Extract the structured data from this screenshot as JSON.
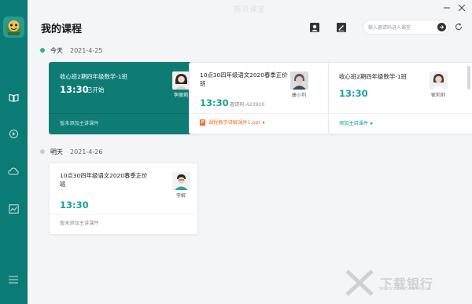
{
  "window": {
    "title": "腾讯课堂",
    "controls": [
      "minimize",
      "close"
    ]
  },
  "sidebar": {
    "items": [
      {
        "icon": "book-icon"
      },
      {
        "icon": "replay-icon"
      },
      {
        "icon": "cloud-icon"
      },
      {
        "icon": "chart-icon"
      },
      {
        "icon": "menu-icon"
      }
    ]
  },
  "header": {
    "title": "我的课程",
    "search_placeholder": "输入邀请码进入课堂"
  },
  "sections": [
    {
      "label": "今天",
      "date": "2021-4-25",
      "dot_color": "#2fb39a",
      "cards": [
        {
          "title": "收心班2期四年级数学-1班",
          "time": "13:30",
          "status": "已开始",
          "teacher": "李丽莉",
          "footer": "暂未添加主讲课件",
          "active": true
        },
        {
          "title": "10点30四年级语文2020春季正价班",
          "time": "13:30",
          "code": "邀请码:423910",
          "teacher": "康小利",
          "footer": "课程教学讲解课件1.ppt",
          "active": false
        },
        {
          "title": "收心班2期四年级数学-1班",
          "time": "13:30",
          "teacher": "崔莉莉",
          "footer": "添加主讲课件",
          "active": false
        }
      ]
    },
    {
      "label": "明天",
      "date": "2021-4-26",
      "dot_color": "#c9cdd2",
      "cards": [
        {
          "title": "10点30四年级语文2020春季正价班",
          "time": "13:30",
          "teacher": "李解",
          "footer": "暂未添加主讲课件",
          "active": false
        }
      ]
    }
  ],
  "watermark": {
    "text": "下载银行",
    "sub": "www.downbank.cn"
  },
  "colors": {
    "sidebar": "#0b7c75",
    "accent": "#17a398",
    "active_card": "#0e7c75",
    "ppt_orange": "#f0772d"
  }
}
